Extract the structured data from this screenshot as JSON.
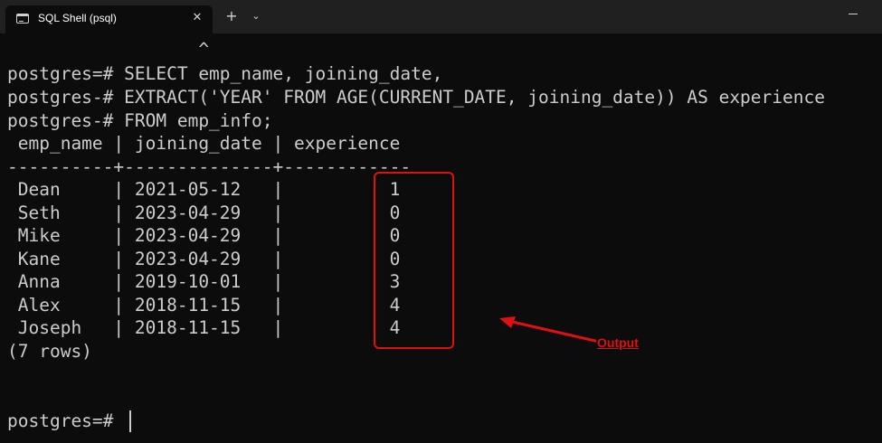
{
  "window": {
    "tab_title": "SQL Shell (psql)",
    "tab_close": "✕",
    "new_tab": "+",
    "dropdown": "⌄"
  },
  "terminal": {
    "lines": [
      "                  ^",
      "postgres=# SELECT emp_name, joining_date,",
      "postgres-# EXTRACT('YEAR' FROM AGE(CURRENT_DATE, joining_date)) AS experience",
      "postgres-# FROM emp_info;",
      " emp_name | joining_date | experience",
      "----------+--------------+------------",
      " Dean     | 2021-05-12   |          1",
      " Seth     | 2023-04-29   |          0",
      " Mike     | 2023-04-29   |          0",
      " Kane     | 2023-04-29   |          0",
      " Anna     | 2019-10-01   |          3",
      " Alex     | 2018-11-15   |          4",
      " Joseph   | 2018-11-15   |          4",
      "(7 rows)",
      "",
      "",
      "postgres=# "
    ]
  },
  "annotation": {
    "label": "Output",
    "color": "#e01010"
  }
}
